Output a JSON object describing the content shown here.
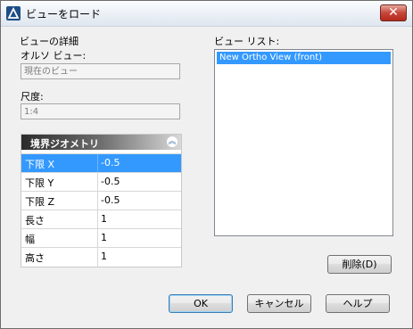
{
  "window": {
    "title": "ビューをロード",
    "close_symbol": "✕"
  },
  "details": {
    "group_label": "ビューの詳細",
    "ortho_view_label": "オルソ ビュー:",
    "ortho_view_value": "現在のビュー",
    "scale_label": "尺度:",
    "scale_value": "1:4"
  },
  "boundary_panel": {
    "title": "境界ジオメトリ",
    "collapse_symbol": "︽",
    "rows": [
      {
        "key": "下限 X",
        "value": "-0.5",
        "selected": true
      },
      {
        "key": "下限 Y",
        "value": "-0.5"
      },
      {
        "key": "下限 Z",
        "value": "-0.5"
      },
      {
        "key": "長さ",
        "value": "1"
      },
      {
        "key": "幅",
        "value": "1"
      },
      {
        "key": "高さ",
        "value": "1"
      }
    ]
  },
  "view_list": {
    "label": "ビュー リスト:",
    "items": [
      "New  Ortho View (front)"
    ]
  },
  "buttons": {
    "delete": "削除(D)",
    "ok": "OK",
    "cancel": "キャンセル",
    "help": "ヘルプ"
  },
  "colors": {
    "selection": "#3399ff",
    "close_red": "#c6463a"
  }
}
